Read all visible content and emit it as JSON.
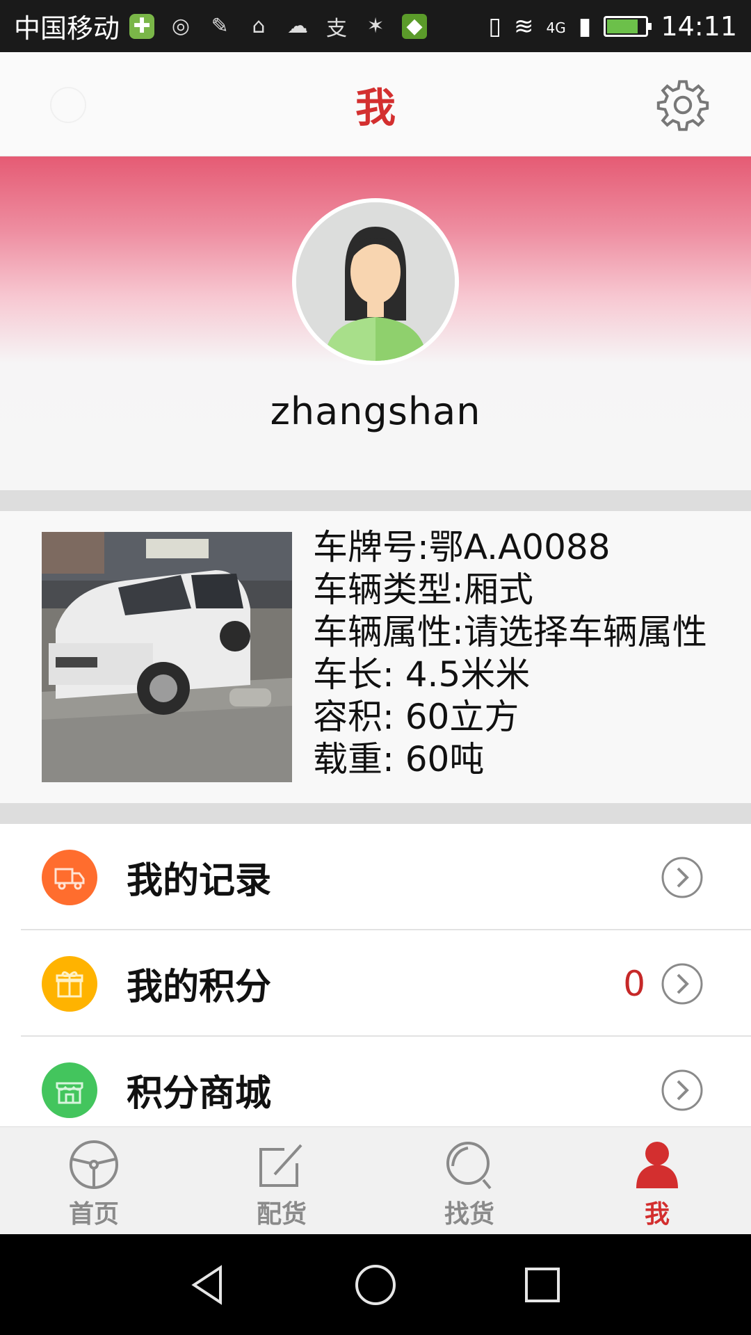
{
  "status_bar": {
    "carrier": "中国移动",
    "network": "4G",
    "time": "14:11"
  },
  "header": {
    "title": "我",
    "settings_icon": "gear-icon"
  },
  "profile": {
    "username": "zhangshan",
    "avatar_icon": "user-avatar"
  },
  "vehicle": {
    "plate": "车牌号:鄂A.A0088",
    "type": "车辆类型:厢式",
    "attribute": "车辆属性:请选择车辆属性",
    "length": "车长: 4.5米米",
    "volume": "容积: 60立方",
    "load": "载重: 60吨"
  },
  "menu": {
    "items": [
      {
        "label": "我的记录",
        "icon": "truck-icon",
        "color": "#ff6d2e",
        "value": ""
      },
      {
        "label": "我的积分",
        "icon": "gift-icon",
        "color": "#ffb300",
        "value": "0"
      },
      {
        "label": "积分商城",
        "icon": "store-icon",
        "color": "#43c55d",
        "value": ""
      }
    ]
  },
  "bottom_nav": {
    "tabs": [
      {
        "label": "首页",
        "icon": "steering-wheel-icon"
      },
      {
        "label": "配货",
        "icon": "edit-icon"
      },
      {
        "label": "找货",
        "icon": "search-icon"
      },
      {
        "label": "我",
        "icon": "person-icon",
        "active": true
      }
    ]
  },
  "colors": {
    "accent": "#d32f2f",
    "banner_top": "#e55b74"
  }
}
